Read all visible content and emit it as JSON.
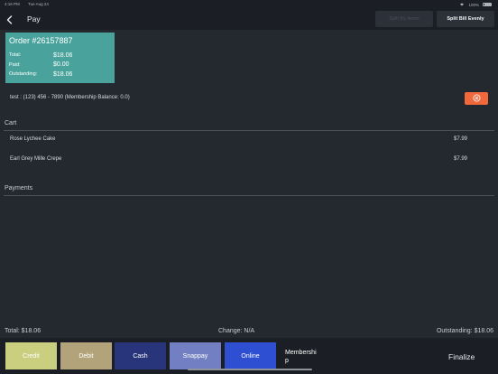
{
  "status_bar": {
    "time": "4:16 PM",
    "date": "Tue Aug 24",
    "battery": "100%"
  },
  "header": {
    "title": "Pay",
    "disabled_button_label": "Split By Items",
    "split_button_label": "Split Bill Evenly"
  },
  "order": {
    "title": "Order #26157887",
    "rows": [
      {
        "label": "Total:",
        "value": "$18.06"
      },
      {
        "label": "Paid:",
        "value": "$0.00"
      },
      {
        "label": "Outstanding:",
        "value": "$18.06"
      }
    ]
  },
  "customer": {
    "line": "test : (123) 456 - 7890 (Membership Balance: 0.0)"
  },
  "cart": {
    "title": "Cart",
    "items": [
      {
        "name": "Rose Lychee Cake",
        "price": "$7.99"
      },
      {
        "name": "Earl Grey Mille Crepe",
        "price": "$7.99"
      }
    ]
  },
  "payments": {
    "title": "Payments"
  },
  "summary": {
    "total": "Total: $18.06",
    "change": "Change: N/A",
    "outstanding": "Outstanding: $18.06"
  },
  "payment_methods": [
    {
      "label": "Credit",
      "color": "#c9cf7e"
    },
    {
      "label": "Debit",
      "color": "#b2a37b"
    },
    {
      "label": "Cash",
      "color": "#28357a"
    },
    {
      "label": "Snappay",
      "color": "#7280c3"
    },
    {
      "label": "Online",
      "color": "#2f4fd2"
    }
  ],
  "membership_label": "Membershi\np",
  "finalize_label": "Finalize",
  "colors": {
    "accent_card": "#49a39c",
    "remove": "#f1683c",
    "background": "#24282f"
  }
}
